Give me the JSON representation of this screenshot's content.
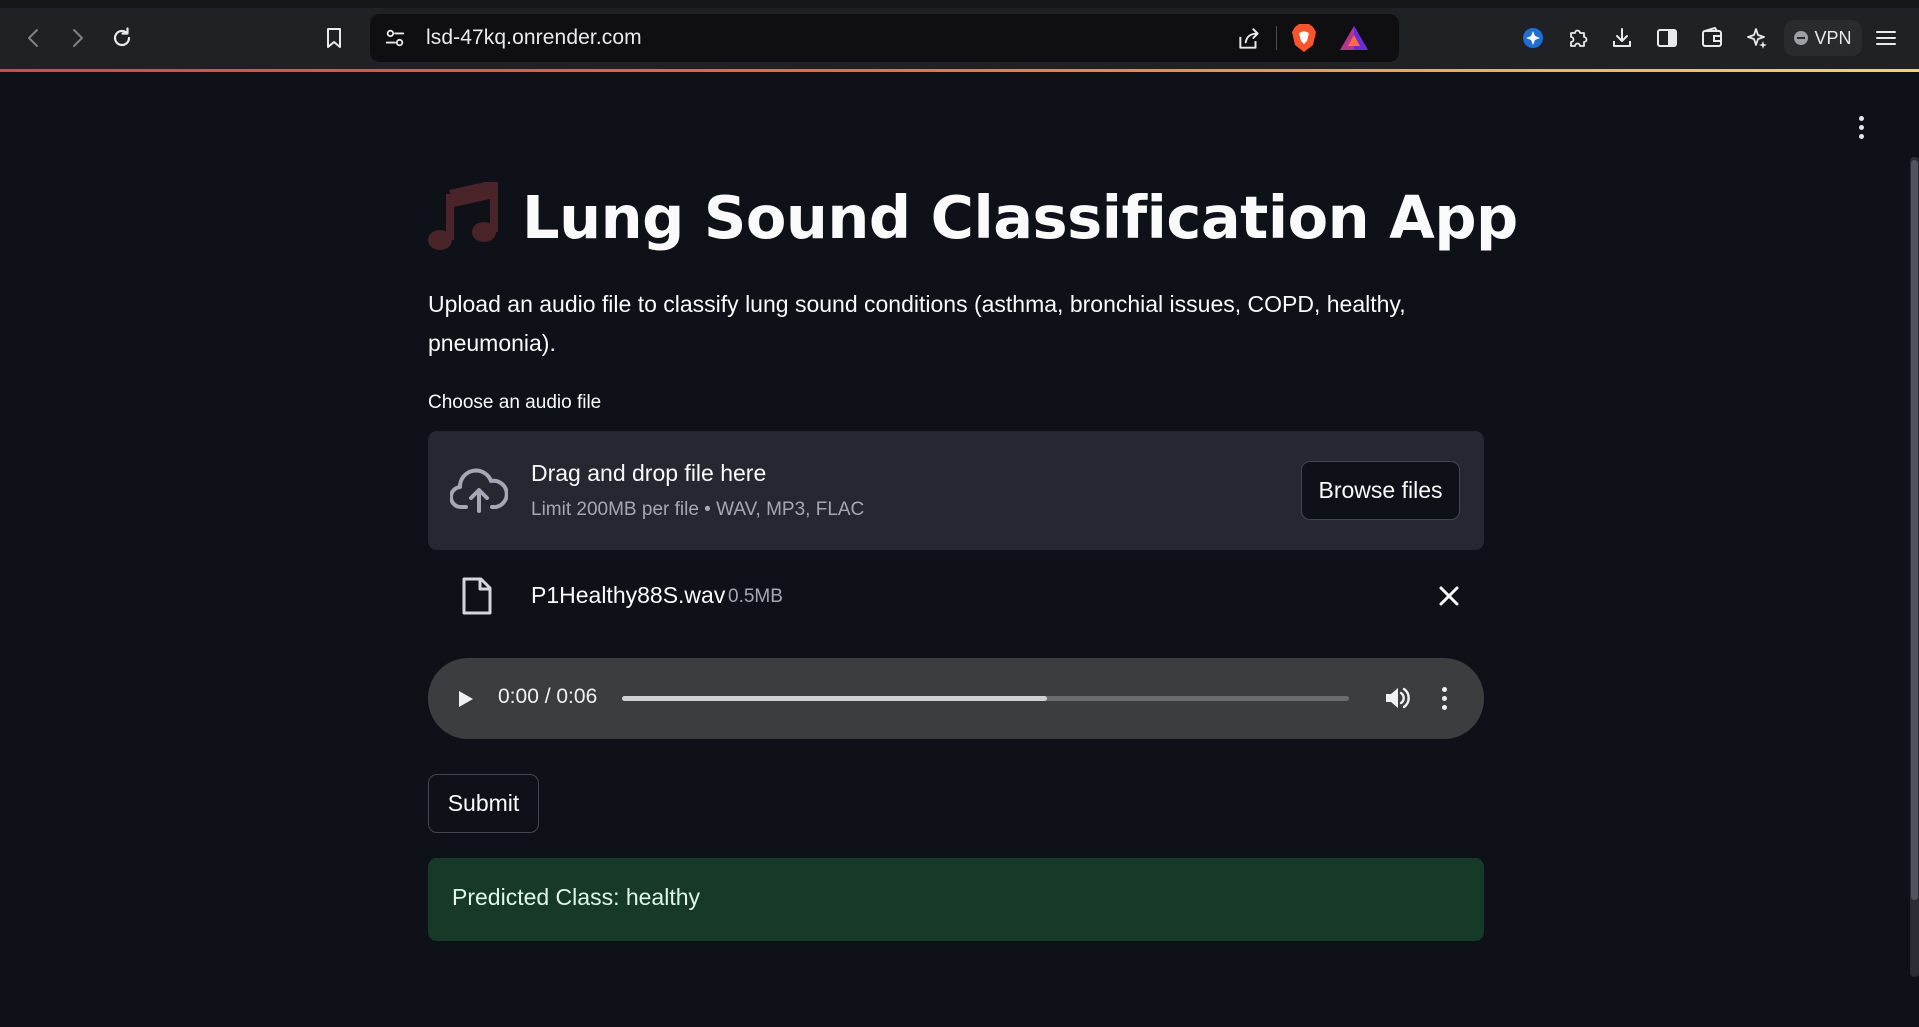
{
  "browser": {
    "url": "lsd-47kq.onrender.com",
    "vpn_label": "VPN"
  },
  "app": {
    "title": "Lung Sound Classification App",
    "title_icon": "musical-notes-icon",
    "description": "Upload an audio file to classify lung sound conditions (asthma, bronchial issues, COPD, healthy, pneumonia).",
    "uploader": {
      "label": "Choose an audio file",
      "drop_title": "Drag and drop file here",
      "drop_limit": "Limit 200MB per file • WAV, MP3, FLAC",
      "browse_label": "Browse files"
    },
    "uploaded_file": {
      "name": "P1Healthy88S.wav",
      "size": "0.5MB"
    },
    "audio_player": {
      "time": "0:00 / 0:06",
      "buffered_fraction": 0.585
    },
    "submit_label": "Submit",
    "result_text": "Predicted Class: healthy"
  },
  "colors": {
    "background": "#0e1117",
    "dropzone": "#262730",
    "success_bg": "#173928",
    "success_text": "#dff6e8",
    "progress_accent": "#e0424a"
  }
}
